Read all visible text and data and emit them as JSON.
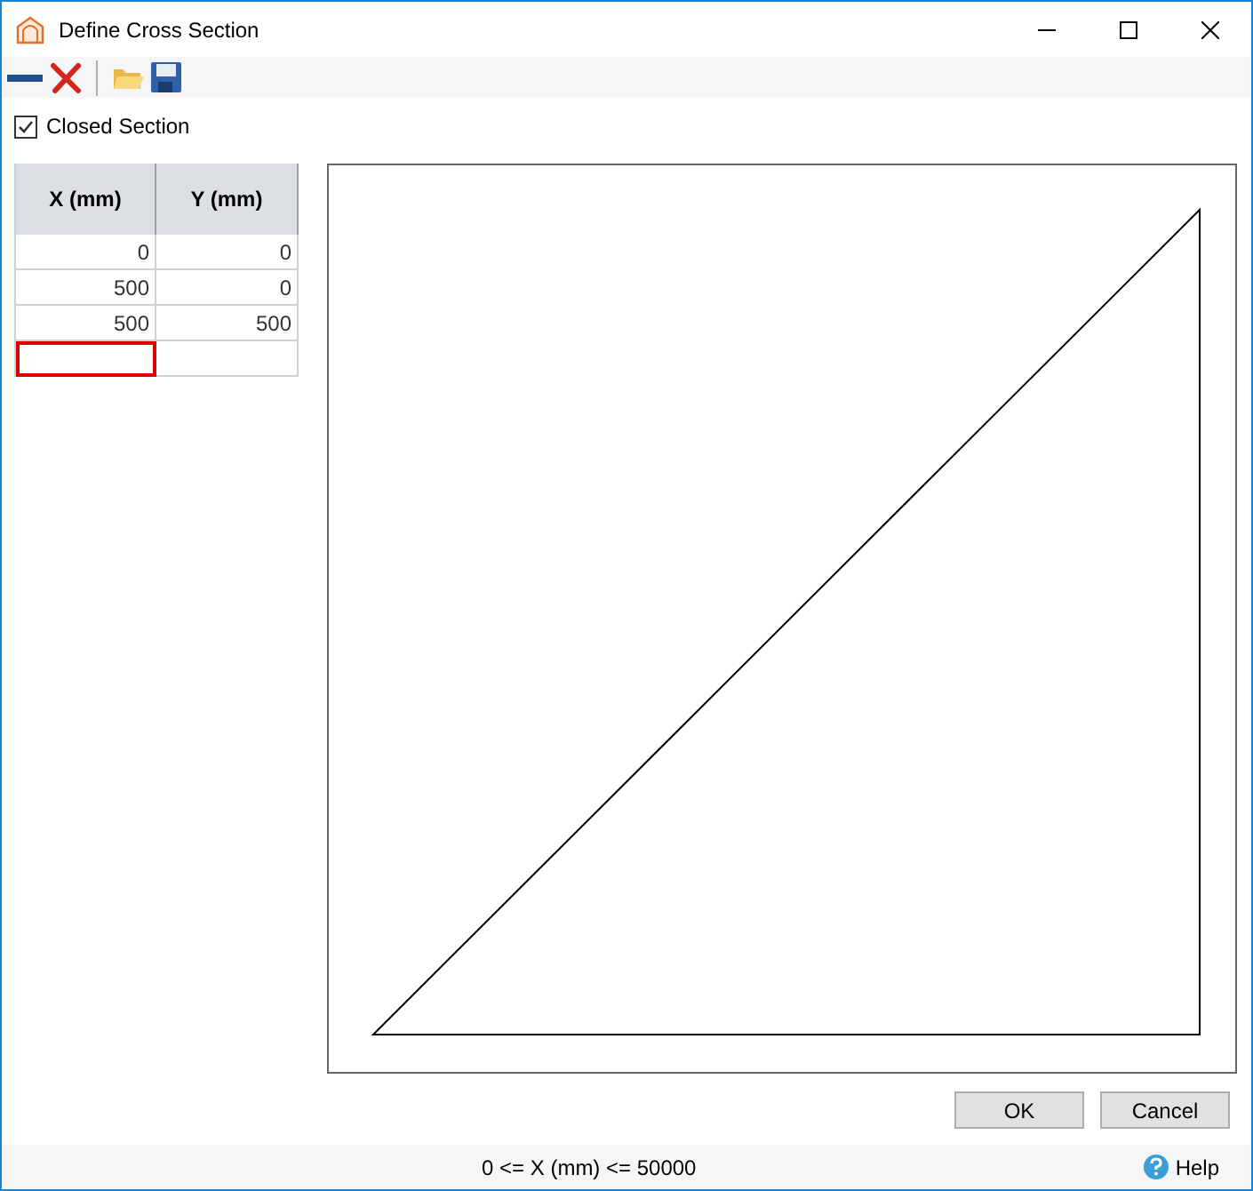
{
  "window": {
    "title": "Define Cross Section"
  },
  "toolbar": [
    {
      "kind": "line"
    },
    {
      "kind": "delete"
    },
    {
      "kind": "separator"
    },
    {
      "kind": "open"
    },
    {
      "kind": "save"
    }
  ],
  "closed_section": {
    "label": "Closed Section",
    "checked": true
  },
  "table": {
    "columns": [
      "X (mm)",
      "Y (mm)"
    ],
    "rows": [
      [
        "0",
        "0"
      ],
      [
        "500",
        "0"
      ],
      [
        "500",
        "500"
      ]
    ],
    "new_row": [
      {
        "selected": true
      },
      {
        "selected": false
      }
    ]
  },
  "buttons": [
    "OK",
    "Cancel"
  ],
  "status_bar": {
    "hint": "0 <= X (mm) <= 50000",
    "help": "Help"
  }
}
